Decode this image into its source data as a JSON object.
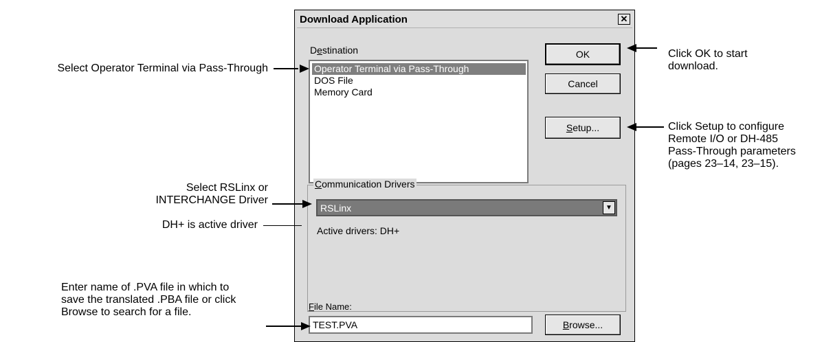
{
  "dialog": {
    "title": "Download Application",
    "close_glyph": "✕",
    "destination_label_pre": "D",
    "destination_label_u": "e",
    "destination_label_post": "stination",
    "destinations": [
      "Operator Terminal via Pass-Through",
      "DOS  File",
      "Memory Card"
    ],
    "selected_destination_index": 0,
    "buttons": {
      "ok": "OK",
      "cancel": "Cancel",
      "setup_u": "S",
      "setup_rest": "etup...",
      "browse_u": "B",
      "browse_rest": "rowse..."
    },
    "comm_group_u": "C",
    "comm_group_rest": "ommunication Drivers",
    "driver_selected": "RSLinx",
    "active_drivers_text": "Active drivers: DH+",
    "filename_label_u": "F",
    "filename_label_rest": "ile Name:",
    "filename_value": "TEST.PVA",
    "combo_arrow": "▼"
  },
  "annotations": {
    "select_operator": "Select Operator Terminal via Pass-Through",
    "click_ok": [
      "Click OK to start",
      "download."
    ],
    "click_setup": [
      "Click Setup to configure",
      "Remote I/O or DH-485",
      "Pass-Through parameters",
      "(pages  23–14,  23–15)."
    ],
    "select_driver": [
      "Select RSLinx or",
      "INTERCHANGE Driver"
    ],
    "dh_active": "DH+ is active driver",
    "enter_name": [
      "Enter name of .PVA file in which to",
      "save the translated .PBA file or click",
      "Browse to search for a file."
    ]
  }
}
